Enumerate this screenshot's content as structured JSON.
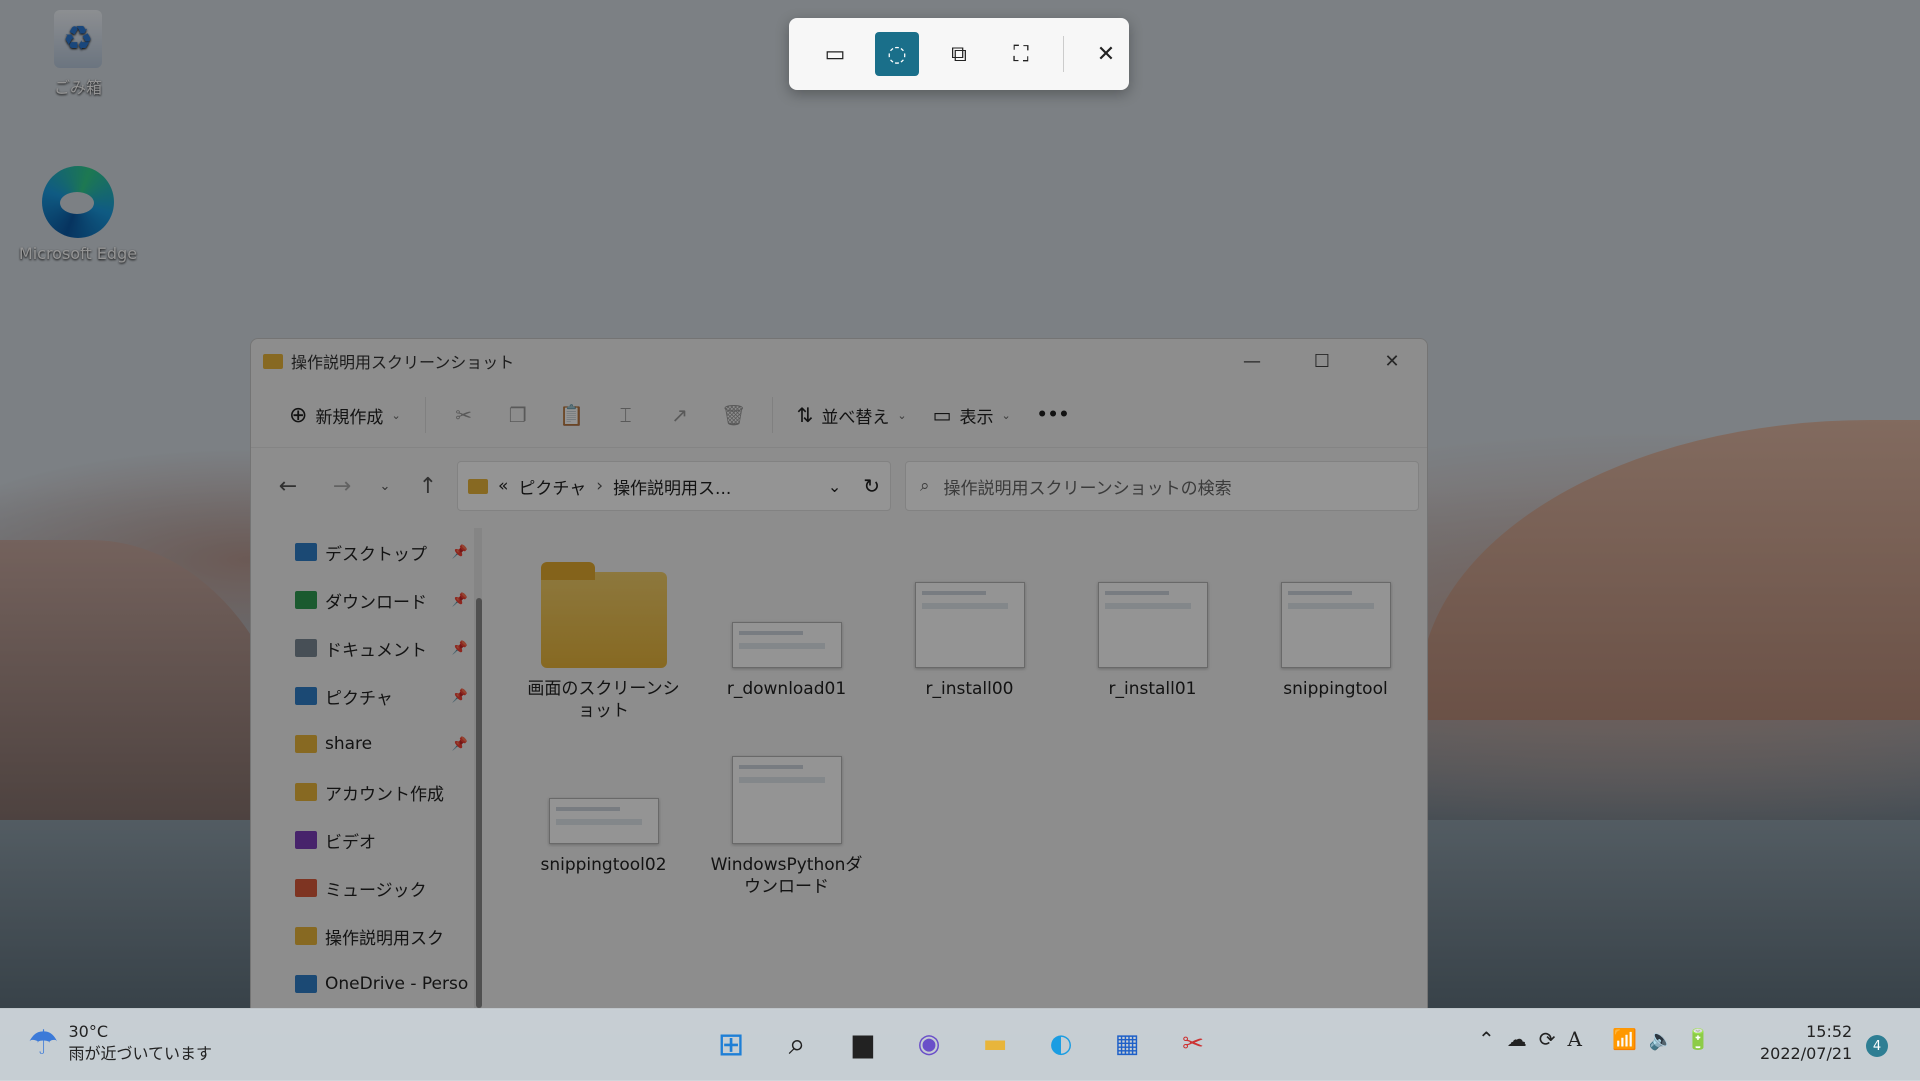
{
  "desktop": {
    "icons": [
      {
        "label": "ごみ箱",
        "icon": "recycle-bin-icon"
      },
      {
        "label": "Microsoft Edge",
        "icon": "edge-icon"
      }
    ]
  },
  "snip_toolbar": {
    "modes": [
      {
        "icon": "rectangle-snip-icon",
        "active": false
      },
      {
        "icon": "freeform-snip-icon",
        "active": true
      },
      {
        "icon": "window-snip-icon",
        "active": false
      },
      {
        "icon": "fullscreen-snip-icon",
        "active": false
      }
    ],
    "close_icon": "close-icon"
  },
  "explorer": {
    "title": "操作説明用スクリーンショット",
    "toolbar": {
      "new_label": "新規作成",
      "sort_label": "並べ替え",
      "view_label": "表示",
      "more_label": "•••"
    },
    "address": {
      "prefix": "«",
      "crumbs": [
        "ピクチャ",
        "操作説明用ス..."
      ]
    },
    "search_placeholder": "操作説明用スクリーンショットの検索",
    "nav_items": [
      {
        "label": "デスクトップ",
        "pinned": true,
        "color": "#2f7fc8"
      },
      {
        "label": "ダウンロード",
        "pinned": true,
        "color": "#2f9b52"
      },
      {
        "label": "ドキュメント",
        "pinned": true,
        "color": "#7b8894"
      },
      {
        "label": "ピクチャ",
        "pinned": true,
        "color": "#2f7fc8"
      },
      {
        "label": "share",
        "pinned": true,
        "color": "#e8b53b"
      },
      {
        "label": "アカウント作成",
        "pinned": false,
        "color": "#e8b53b"
      },
      {
        "label": "ビデオ",
        "pinned": false,
        "color": "#7a3db8"
      },
      {
        "label": "ミュージック",
        "pinned": false,
        "color": "#d95b3b"
      },
      {
        "label": "操作説明用スク",
        "pinned": false,
        "color": "#e8b53b"
      },
      {
        "label": "OneDrive - Perso",
        "pinned": false,
        "color": "#2f7fc8"
      }
    ],
    "files": [
      {
        "name": "画面のスクリーンショット",
        "kind": "folder"
      },
      {
        "name": "r_download01",
        "kind": "image",
        "thumb": "wide"
      },
      {
        "name": "r_install00",
        "kind": "image",
        "thumb": "square"
      },
      {
        "name": "r_install01",
        "kind": "image",
        "thumb": "square"
      },
      {
        "name": "snippingtool",
        "kind": "image",
        "thumb": "square"
      },
      {
        "name": "snippingtool02",
        "kind": "image",
        "thumb": "wide"
      },
      {
        "name": "WindowsPythonダウンロード",
        "kind": "image",
        "thumb": "tall"
      }
    ]
  },
  "taskbar": {
    "weather_temp": "30°C",
    "weather_desc": "雨が近づいています",
    "time": "15:52",
    "date": "2022/07/21",
    "notification_count": "4",
    "ime": "A"
  },
  "colors": {
    "accent": "#1a6f8a",
    "folder": "#e8b53b"
  }
}
